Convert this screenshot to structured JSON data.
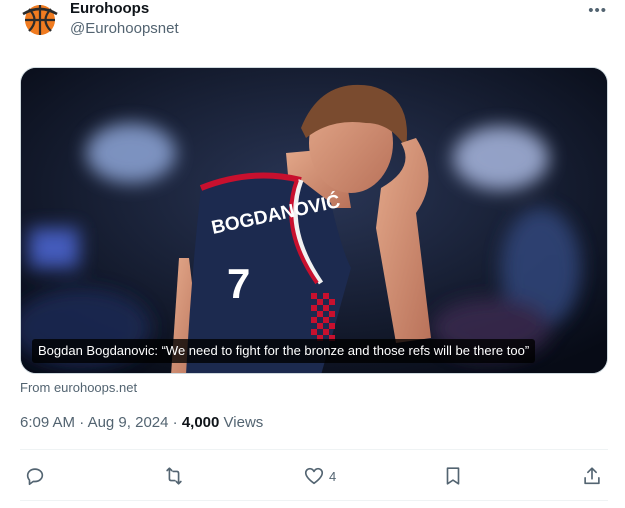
{
  "author": {
    "display_name": "Eurohoops",
    "handle": "@Eurohoopsnet",
    "avatar_icon": "basketball-logo-icon"
  },
  "menu": {
    "more_label": "•••"
  },
  "media": {
    "caption": "Bogdan Bogdanovic: “We need to fight for the bronze and those refs will be there too”",
    "jersey_name": "BOGDANOVIĆ",
    "jersey_number": "7"
  },
  "source": "From eurohoops.net",
  "meta": {
    "time": "6:09 AM",
    "date": "Aug 9, 2024",
    "separator": " · ",
    "views_count": "4,000",
    "views_label": "Views"
  },
  "actions": {
    "reply_icon": "reply-icon",
    "retweet_icon": "retweet-icon",
    "like_icon": "heart-icon",
    "like_count": "4",
    "bookmark_icon": "bookmark-icon",
    "share_icon": "share-icon"
  },
  "colors": {
    "text": "#0f1419",
    "secondary": "#536471",
    "jersey_navy": "#1c2a4f",
    "jersey_red": "#c8102e"
  }
}
